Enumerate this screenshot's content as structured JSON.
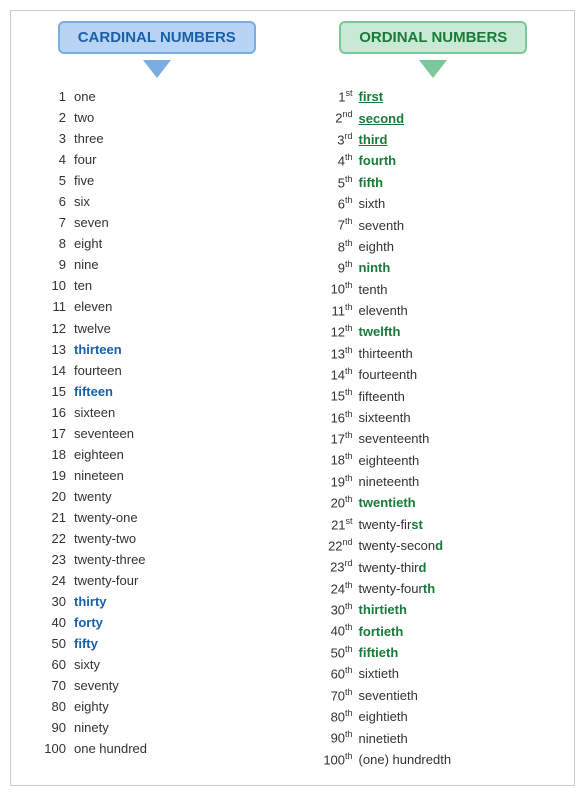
{
  "headers": {
    "cardinal": "CARDINAL NUMBERS",
    "ordinal": "ORDINAL NUMBERS"
  },
  "cardinal_rows": [
    {
      "num": "1",
      "word": "one",
      "style": "normal"
    },
    {
      "num": "2",
      "word": "two",
      "style": "normal"
    },
    {
      "num": "3",
      "word": "three",
      "style": "normal"
    },
    {
      "num": "4",
      "word": "four",
      "style": "normal"
    },
    {
      "num": "5",
      "word": "five",
      "style": "normal"
    },
    {
      "num": "6",
      "word": "six",
      "style": "normal"
    },
    {
      "num": "7",
      "word": "seven",
      "style": "normal"
    },
    {
      "num": "8",
      "word": "eight",
      "style": "normal"
    },
    {
      "num": "9",
      "word": "nine",
      "style": "normal"
    },
    {
      "num": "10",
      "word": "ten",
      "style": "normal"
    },
    {
      "num": "11",
      "word": "eleven",
      "style": "normal"
    },
    {
      "num": "12",
      "word": "twelve",
      "style": "normal"
    },
    {
      "num": "13",
      "word": "thirteen",
      "style": "bold"
    },
    {
      "num": "14",
      "word": "fourteen",
      "style": "normal"
    },
    {
      "num": "15",
      "word": "fifteen",
      "style": "bold"
    },
    {
      "num": "16",
      "word": "sixteen",
      "style": "normal"
    },
    {
      "num": "17",
      "word": "seventeen",
      "style": "normal"
    },
    {
      "num": "18",
      "word": "eighteen",
      "style": "normal"
    },
    {
      "num": "19",
      "word": "nineteen",
      "style": "normal"
    },
    {
      "num": "20",
      "word": "twenty",
      "style": "normal"
    },
    {
      "num": "21",
      "word": "twenty-one",
      "style": "normal"
    },
    {
      "num": "22",
      "word": "twenty-two",
      "style": "normal"
    },
    {
      "num": "23",
      "word": "twenty-three",
      "style": "normal"
    },
    {
      "num": "24",
      "word": "twenty-four",
      "style": "normal"
    },
    {
      "num": "30",
      "word": "thirty",
      "style": "bold"
    },
    {
      "num": "40",
      "word": "forty",
      "style": "bold"
    },
    {
      "num": "50",
      "word": "fifty",
      "style": "bold"
    },
    {
      "num": "60",
      "word": "sixty",
      "style": "normal"
    },
    {
      "num": "70",
      "word": "seventy",
      "style": "normal"
    },
    {
      "num": "80",
      "word": "eighty",
      "style": "normal"
    },
    {
      "num": "90",
      "word": "ninety",
      "style": "normal"
    },
    {
      "num": "100",
      "word": "one hundred",
      "style": "normal"
    }
  ],
  "ordinal_rows": [
    {
      "num": "1",
      "sup": "st",
      "word": "first",
      "style": "bold-underline"
    },
    {
      "num": "2",
      "sup": "nd",
      "word": "second",
      "style": "bold-underline"
    },
    {
      "num": "3",
      "sup": "rd",
      "word": "third",
      "style": "bold-underline"
    },
    {
      "num": "4",
      "sup": "th",
      "word": "fourth",
      "style": "bold"
    },
    {
      "num": "5",
      "sup": "th",
      "word": "fifth",
      "style": "bold"
    },
    {
      "num": "6",
      "sup": "th",
      "word": "sixth",
      "style": "normal"
    },
    {
      "num": "7",
      "sup": "th",
      "word": "seventh",
      "style": "normal"
    },
    {
      "num": "8",
      "sup": "th",
      "word": "eighth",
      "style": "normal"
    },
    {
      "num": "9",
      "sup": "th",
      "word": "ninth",
      "style": "bold"
    },
    {
      "num": "10",
      "sup": "th",
      "word": "tenth",
      "style": "normal"
    },
    {
      "num": "11",
      "sup": "th",
      "word": "eleventh",
      "style": "normal"
    },
    {
      "num": "12",
      "sup": "th",
      "word": "twelfth",
      "style": "bold"
    },
    {
      "num": "13",
      "sup": "th",
      "word": "thirteenth",
      "style": "normal"
    },
    {
      "num": "14",
      "sup": "th",
      "word": "fourteenth",
      "style": "normal"
    },
    {
      "num": "15",
      "sup": "th",
      "word": "fifteenth",
      "style": "normal"
    },
    {
      "num": "16",
      "sup": "th",
      "word": "sixteenth",
      "style": "normal"
    },
    {
      "num": "17",
      "sup": "th",
      "word": "seventeenth",
      "style": "normal"
    },
    {
      "num": "18",
      "sup": "th",
      "word": "eighteenth",
      "style": "normal"
    },
    {
      "num": "19",
      "sup": "th",
      "word": "nineteenth",
      "style": "normal"
    },
    {
      "num": "20",
      "sup": "th",
      "word": "twentieth",
      "style": "bold"
    },
    {
      "num": "21",
      "sup": "st",
      "word": "twenty-fir",
      "bold_suffix": "st",
      "style": "mixed"
    },
    {
      "num": "22",
      "sup": "nd",
      "word": "twenty-second",
      "bold_suffix": "d",
      "style": "mixed2"
    },
    {
      "num": "23",
      "sup": "rd",
      "word": "twenty-thir",
      "bold_suffix": "d",
      "style": "mixed"
    },
    {
      "num": "24",
      "sup": "th",
      "word": "twenty-four",
      "bold_suffix": "th",
      "style": "mixed"
    },
    {
      "num": "30",
      "sup": "th",
      "word": "thirtieth",
      "style": "bold"
    },
    {
      "num": "40",
      "sup": "th",
      "word": "fortieth",
      "style": "bold"
    },
    {
      "num": "50",
      "sup": "th",
      "word": "fiftieth",
      "style": "bold"
    },
    {
      "num": "60",
      "sup": "th",
      "word": "sixtieth",
      "style": "normal"
    },
    {
      "num": "70",
      "sup": "th",
      "word": "seventieth",
      "style": "normal"
    },
    {
      "num": "80",
      "sup": "th",
      "word": "eightieth",
      "style": "normal"
    },
    {
      "num": "90",
      "sup": "th",
      "word": "ninetieth",
      "style": "normal"
    },
    {
      "num": "100",
      "sup": "th",
      "word": "(one) hundredth",
      "style": "normal"
    }
  ]
}
